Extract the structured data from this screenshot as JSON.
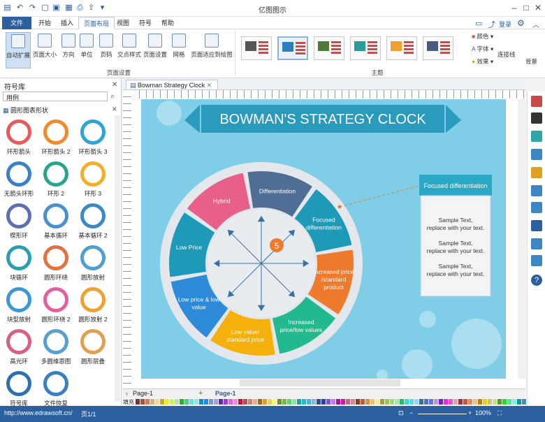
{
  "app": {
    "title": "亿图图示"
  },
  "menus": [
    "文件",
    "开始",
    "插入",
    "页面布局",
    "视图",
    "符号",
    "帮助"
  ],
  "login": "登录",
  "ribbon": {
    "buttons": [
      "自动扩展",
      "页面大小",
      "方向",
      "单位",
      "页码",
      "交点样式",
      "页面设置",
      "网格",
      "页面适应到绘图"
    ],
    "group1": "页面设置",
    "group2": "主题",
    "right": [
      "颜色",
      "字体",
      "效果"
    ],
    "connector": "连接线",
    "bg": "背景"
  },
  "sidebar": {
    "title": "符号库",
    "search": "用例",
    "category": "圆形图表形状",
    "items": [
      "环形箭头",
      "环形箭头 2",
      "环形箭头 3",
      "无箭头环形",
      "环形 2",
      "环形 3",
      "楔形环",
      "基本循环",
      "基本循环 2",
      "块循环",
      "圆形环绕",
      "圆形放射",
      "块型放射",
      "圆形环绕 2",
      "圆形放射 2",
      "高光环",
      "多圆维恩图",
      "圆形层叠",
      "符号库",
      "文件恢复"
    ]
  },
  "doc": {
    "tab": "Bowman Strategy Clock",
    "page_tab": "Page-1",
    "page_active": "Page-1",
    "fill_label": "填充"
  },
  "diagram": {
    "title": "BOWMAN'S STRATEGY CLOCK",
    "center_number": "5",
    "segments": [
      {
        "label": "Hybrid",
        "color": "#e85f8a"
      },
      {
        "label": "Differentiation",
        "color": "#4e6e96"
      },
      {
        "label": "Focused differentiation",
        "color": "#1e9ab8"
      },
      {
        "label": "Increased price /standard product",
        "color": "#ee7a2d"
      },
      {
        "label": "Increased price/low values",
        "color": "#22b98e"
      },
      {
        "label": "Low value/ standard price",
        "color": "#f5b00b"
      },
      {
        "label": "Low price & low value",
        "color": "#2d8ad8"
      },
      {
        "label": "Low Price",
        "color": "#1e9ab8"
      }
    ],
    "callout": {
      "title": "Focused differentiation",
      "texts": [
        "Sample Text, replace with your text.",
        "Sample Text, replace with your text.",
        "Sample Text, replace with your text."
      ]
    }
  },
  "status": {
    "url": "http://www.edrawsoft.cn/",
    "page": "页1/1",
    "zoom": "100%"
  }
}
